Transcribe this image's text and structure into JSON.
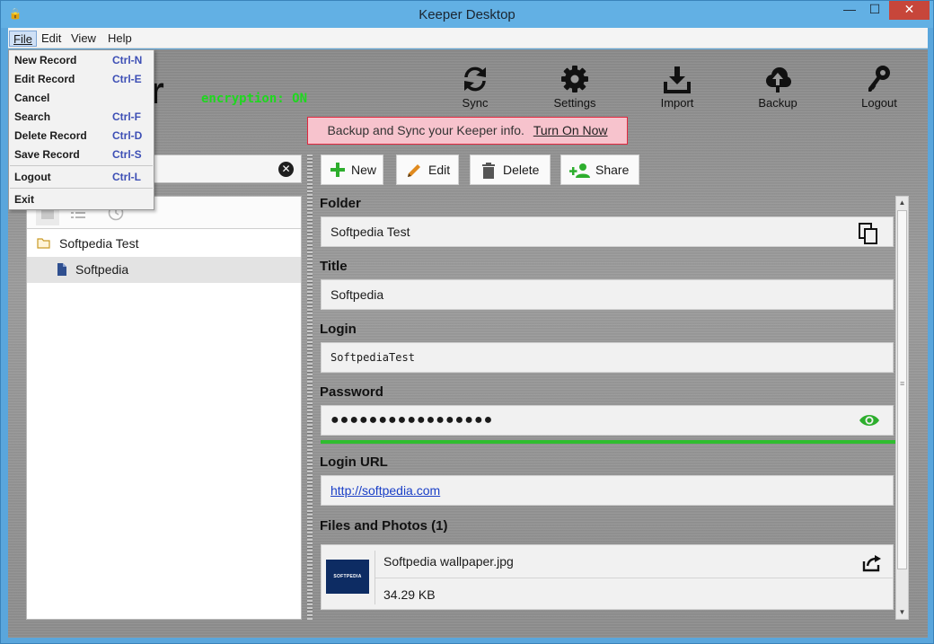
{
  "window": {
    "title": "Keeper Desktop",
    "minimize": "—",
    "maximize": "☐",
    "close": "✕"
  },
  "menubar": {
    "file": "File",
    "edit": "Edit",
    "view": "View",
    "help": "Help"
  },
  "file_menu": {
    "items": [
      {
        "label": "New Record",
        "shortcut": "Ctrl-N"
      },
      {
        "label": "Edit Record",
        "shortcut": "Ctrl-E"
      },
      {
        "label": "Cancel",
        "shortcut": ""
      },
      {
        "label": "Search",
        "shortcut": "Ctrl-F"
      },
      {
        "label": "Delete Record",
        "shortcut": "Ctrl-D"
      },
      {
        "label": "Save Record",
        "shortcut": "Ctrl-S"
      },
      {
        "label": "Logout",
        "shortcut": "Ctrl-L"
      },
      {
        "label": "Exit",
        "shortcut": ""
      }
    ]
  },
  "header": {
    "logo": "er",
    "encryption": "encryption: ON"
  },
  "toolbar": {
    "sync": "Sync",
    "settings": "Settings",
    "import": "Import",
    "backup": "Backup",
    "logout": "Logout"
  },
  "banner": {
    "text": "Backup and Sync your Keeper info.",
    "link": "Turn On Now"
  },
  "search": {
    "value": "",
    "clear": "✕"
  },
  "tree": {
    "folder": "Softpedia Test",
    "record": "Softpedia"
  },
  "actions": {
    "new": "New",
    "edit": "Edit",
    "delete": "Delete",
    "share": "Share"
  },
  "record": {
    "folder_label": "Folder",
    "folder_value": "Softpedia Test",
    "title_label": "Title",
    "title_value": "Softpedia",
    "login_label": "Login",
    "login_value": "SoftpediaTest",
    "password_label": "Password",
    "password_value": "●●●●●●●●●●●●●●●●●",
    "url_label": "Login URL",
    "url_value": "http://softpedia.com",
    "files_label": "Files and Photos  (1)",
    "file_name": "Softpedia wallpaper.jpg",
    "file_size": "34.29 KB",
    "file_thumb_text": "SOFTPEDIA"
  },
  "colors": {
    "encryption_green": "#1ed81e",
    "banner_border": "#e0283f",
    "banner_bg": "#f7c3cd",
    "strength_green": "#2fbd2f",
    "link_blue": "#1a3fc7"
  }
}
